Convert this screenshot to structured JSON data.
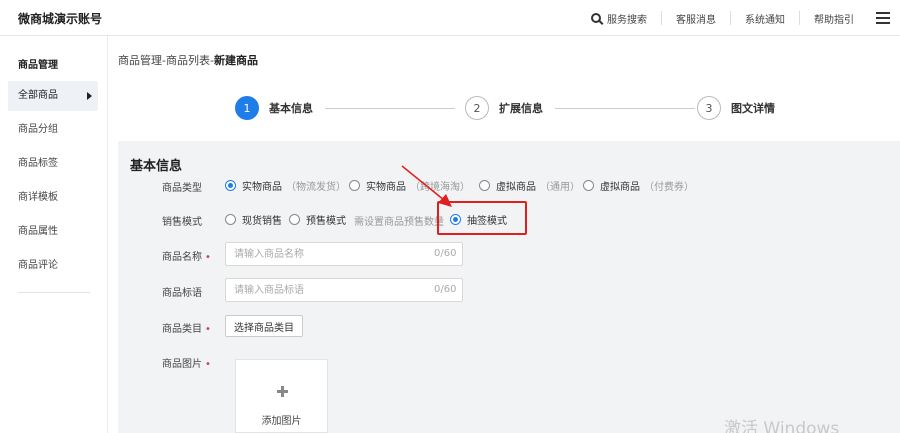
{
  "header": {
    "title": "微商城演示账号",
    "nav": {
      "search": "服务搜索",
      "customer_service": "客服消息",
      "notice": "系统通知",
      "help": "帮助指引"
    }
  },
  "sidebar": {
    "section": "商品管理",
    "items": [
      {
        "label": "全部商品"
      },
      {
        "label": "商品分组"
      },
      {
        "label": "商品标签"
      },
      {
        "label": "商详模板"
      },
      {
        "label": "商品属性"
      },
      {
        "label": "商品评论"
      }
    ]
  },
  "breadcrumb": {
    "path": "商品管理-商品列表-",
    "current": "新建商品"
  },
  "steps": [
    {
      "num": "1",
      "label": "基本信息"
    },
    {
      "num": "2",
      "label": "扩展信息"
    },
    {
      "num": "3",
      "label": "图文详情"
    }
  ],
  "form": {
    "section_title": "基本信息",
    "product_type": {
      "label": "商品类型",
      "options": [
        {
          "label": "实物商品",
          "hint": "（物流发货）"
        },
        {
          "label": "实物商品",
          "hint": "（跨境海淘）"
        },
        {
          "label": "虚拟商品",
          "hint": "（通用）"
        },
        {
          "label": "虚拟商品",
          "hint": "（付费券）"
        }
      ],
      "selected": "实物商品（物流发货）"
    },
    "sale_mode": {
      "label": "销售模式",
      "options": [
        {
          "label": "现货销售"
        },
        {
          "label": "预售模式"
        },
        {
          "label": "抽签模式"
        }
      ],
      "presale_hint": "需设置商品预售数量",
      "selected": "抽签模式"
    },
    "name": {
      "label": "商品名称",
      "placeholder": "请输入商品名称",
      "counter": "0/60"
    },
    "slogan": {
      "label": "商品标语",
      "placeholder": "请输入商品标语",
      "counter": "0/60"
    },
    "category": {
      "label": "商品类目",
      "button": "选择商品类目"
    },
    "images": {
      "label": "商品图片",
      "add_label": "添加图片"
    }
  },
  "annotation_color": "#e02020",
  "accent_color": "#1e7de6",
  "watermark": "激活 Windows"
}
